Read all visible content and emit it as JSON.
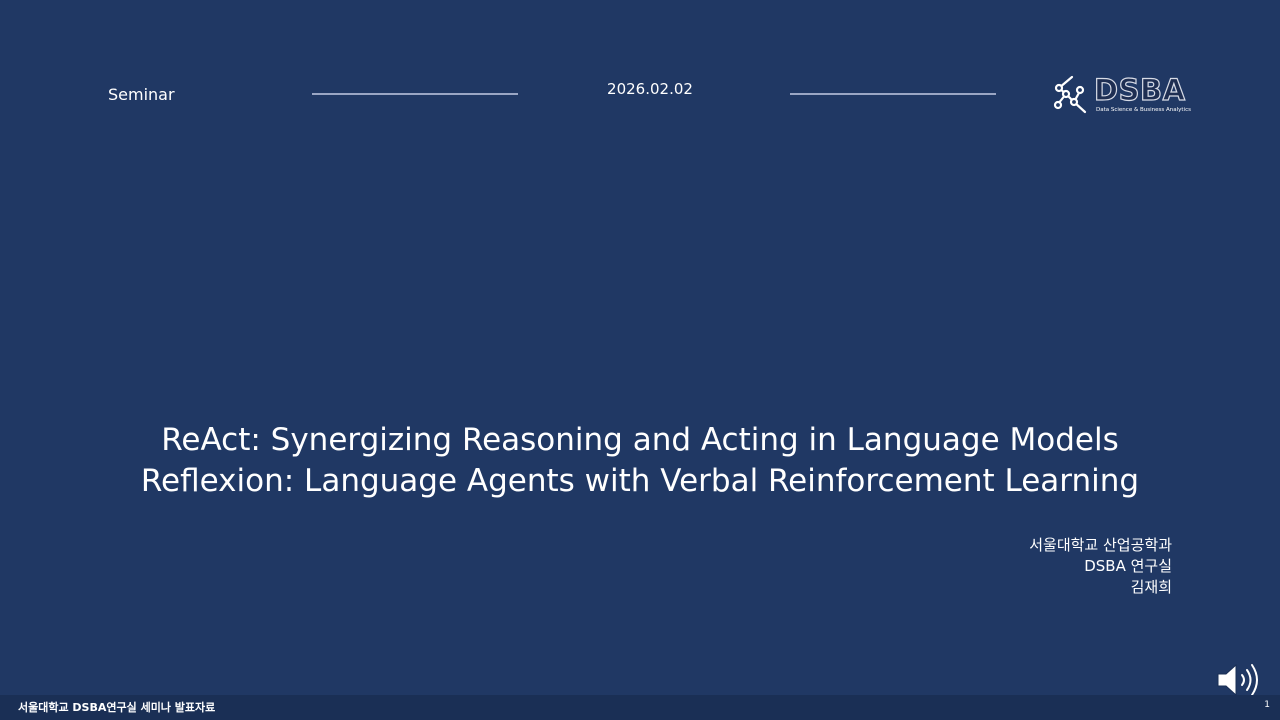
{
  "header": {
    "label": "Seminar",
    "date": "2026.02.02"
  },
  "logo": {
    "text": "DSBA",
    "subtitle": "Data Science & Business Analytics",
    "icon": "network-nodes-icon"
  },
  "title": {
    "line1": "ReAct: Synergizing Reasoning and Acting in Language Models",
    "line2": "Reflexion: Language Agents  with Verbal Reinforcement Learning"
  },
  "author": {
    "affiliation": "서울대학교 산업공학과",
    "lab": "DSBA 연구실",
    "name": "김재희"
  },
  "footer": {
    "text": "서울대학교 DSBA연구실 세미나 발표자료",
    "page": "1"
  },
  "controls": {
    "speaker_icon": "speaker-volume-icon"
  },
  "colors": {
    "background": "#203864",
    "footer": "#1a2f55",
    "text": "#ffffff",
    "rule": "#9aa6c4"
  }
}
